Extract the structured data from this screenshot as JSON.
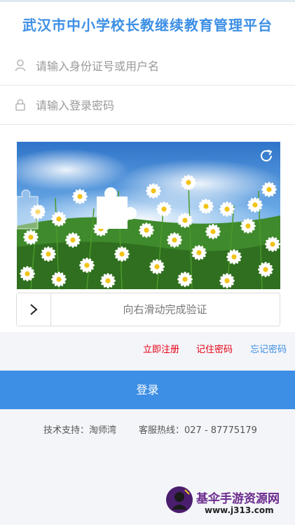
{
  "app": {
    "title": "武汉市中小学校长教继续教育管理平台"
  },
  "form": {
    "username_placeholder": "请输入身份证号或用户名",
    "username_value": "",
    "password_placeholder": "请输入登录密码",
    "password_value": ""
  },
  "captcha": {
    "slider_text": "向右滑动完成验证",
    "refresh_icon": "refresh-icon",
    "handle_icon": "chevron-right-icon"
  },
  "links": {
    "register": "立即注册",
    "remember": "记住密码",
    "forgot": "忘记密码"
  },
  "login_button": "登录",
  "footer": {
    "support": "技术支持：淘师湾",
    "hotline": "客服热线：027 - 87775179"
  },
  "watermark": {
    "name": "基伞手游资源网",
    "url": "www.j313.com"
  },
  "colors": {
    "accent": "#3d8fe5",
    "link_red": "#e60012",
    "background": "#f4f5f9"
  }
}
